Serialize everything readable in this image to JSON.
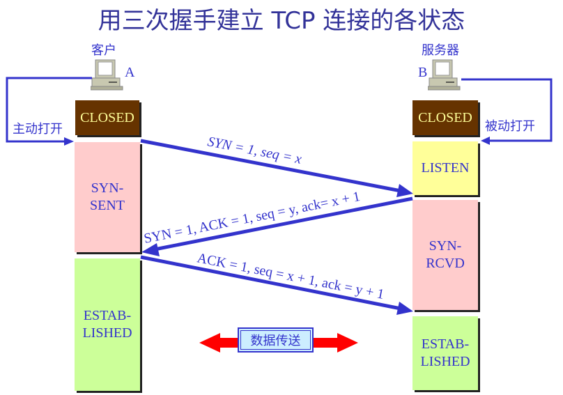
{
  "title": "用三次握手建立 TCP 连接的各状态",
  "client": {
    "role_label": "客户",
    "host_letter": "A",
    "open_label": "主动打开",
    "states": [
      "CLOSED",
      "SYN-\nSENT",
      "ESTAB-\nLISHED"
    ]
  },
  "server": {
    "role_label": "服务器",
    "host_letter": "B",
    "open_label": "被动打开",
    "states": [
      "CLOSED",
      "LISTEN",
      "SYN-\nRCVD",
      "ESTAB-\nLISHED"
    ]
  },
  "messages": [
    {
      "label": "SYN = 1, seq = x",
      "direction": "A→B"
    },
    {
      "label": "SYN = 1, ACK = 1, seq = y, ack= x + 1",
      "direction": "B→A"
    },
    {
      "label": "ACK = 1, seq = x + 1, ack = y + 1",
      "direction": "A→B"
    }
  ],
  "data_transfer": {
    "label": "数据传送"
  },
  "colors": {
    "arrow": "#3333cc",
    "closed_bg": "#663300",
    "closed_text": "#ffff99",
    "syn_bg": "#ffcccc",
    "listen_bg": "#ffff99",
    "established_bg": "#ccff99",
    "data_arrow": "#ff0000",
    "title": "#333399"
  }
}
